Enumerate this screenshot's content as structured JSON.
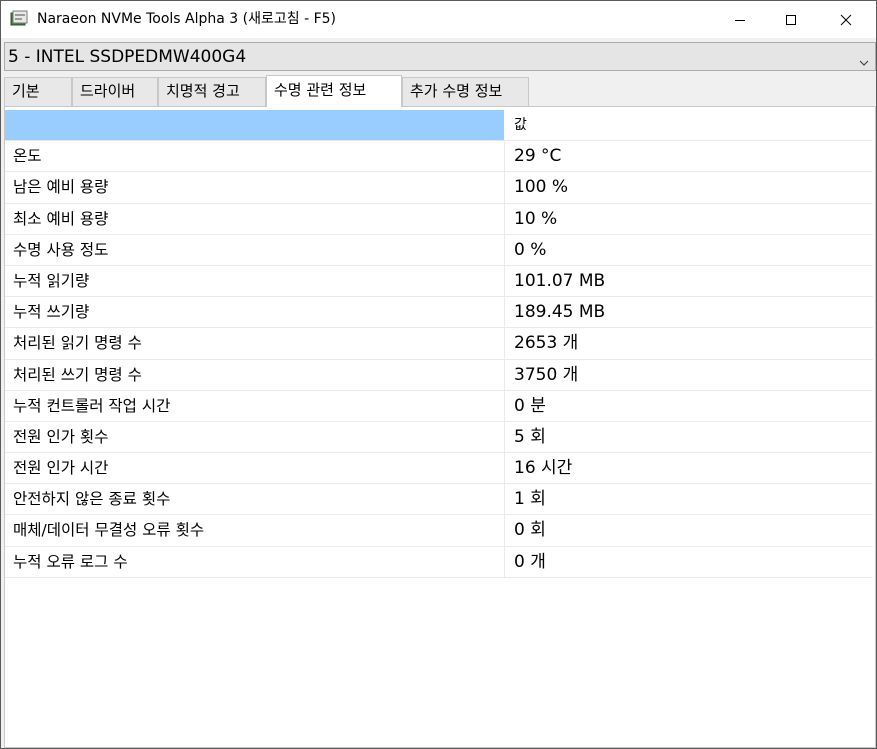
{
  "window": {
    "title": "Naraeon NVMe Tools Alpha 3 (새로고침 - F5)",
    "icon": "ssd-app-icon"
  },
  "drive_select": {
    "value": "5 - INTEL SSDPEDMW400G4"
  },
  "tabs": [
    {
      "label": "기본",
      "active": false
    },
    {
      "label": "드라이버",
      "active": false
    },
    {
      "label": "치명적 경고",
      "active": false
    },
    {
      "label": "수명 관련 정보",
      "active": true
    },
    {
      "label": "추가 수명 정보",
      "active": false
    }
  ],
  "table": {
    "header": {
      "name": "",
      "value": "값"
    },
    "rows": [
      {
        "name": "온도",
        "value": "29 °C"
      },
      {
        "name": "남은 예비 용량",
        "value": "100 %"
      },
      {
        "name": "최소 예비 용량",
        "value": "10 %"
      },
      {
        "name": "수명 사용 정도",
        "value": "0 %"
      },
      {
        "name": "누적 읽기량",
        "value": "101.07 MB"
      },
      {
        "name": "누적 쓰기량",
        "value": "189.45 MB"
      },
      {
        "name": "처리된 읽기 명령 수",
        "value": "2653 개"
      },
      {
        "name": "처리된 쓰기 명령 수",
        "value": "3750 개"
      },
      {
        "name": "누적 컨트롤러 작업 시간",
        "value": "0 분"
      },
      {
        "name": "전원 인가 횟수",
        "value": "5 회"
      },
      {
        "name": "전원 인가 시간",
        "value": "16 시간"
      },
      {
        "name": "안전하지 않은 종료 횟수",
        "value": "1 회"
      },
      {
        "name": "매체/데이터 무결성 오류 횟수",
        "value": "0 회"
      },
      {
        "name": "누적 오류 로그 수",
        "value": "0 개"
      }
    ]
  },
  "colors": {
    "header_highlight": "#99ccff",
    "window_bg": "#f0f0f0"
  }
}
